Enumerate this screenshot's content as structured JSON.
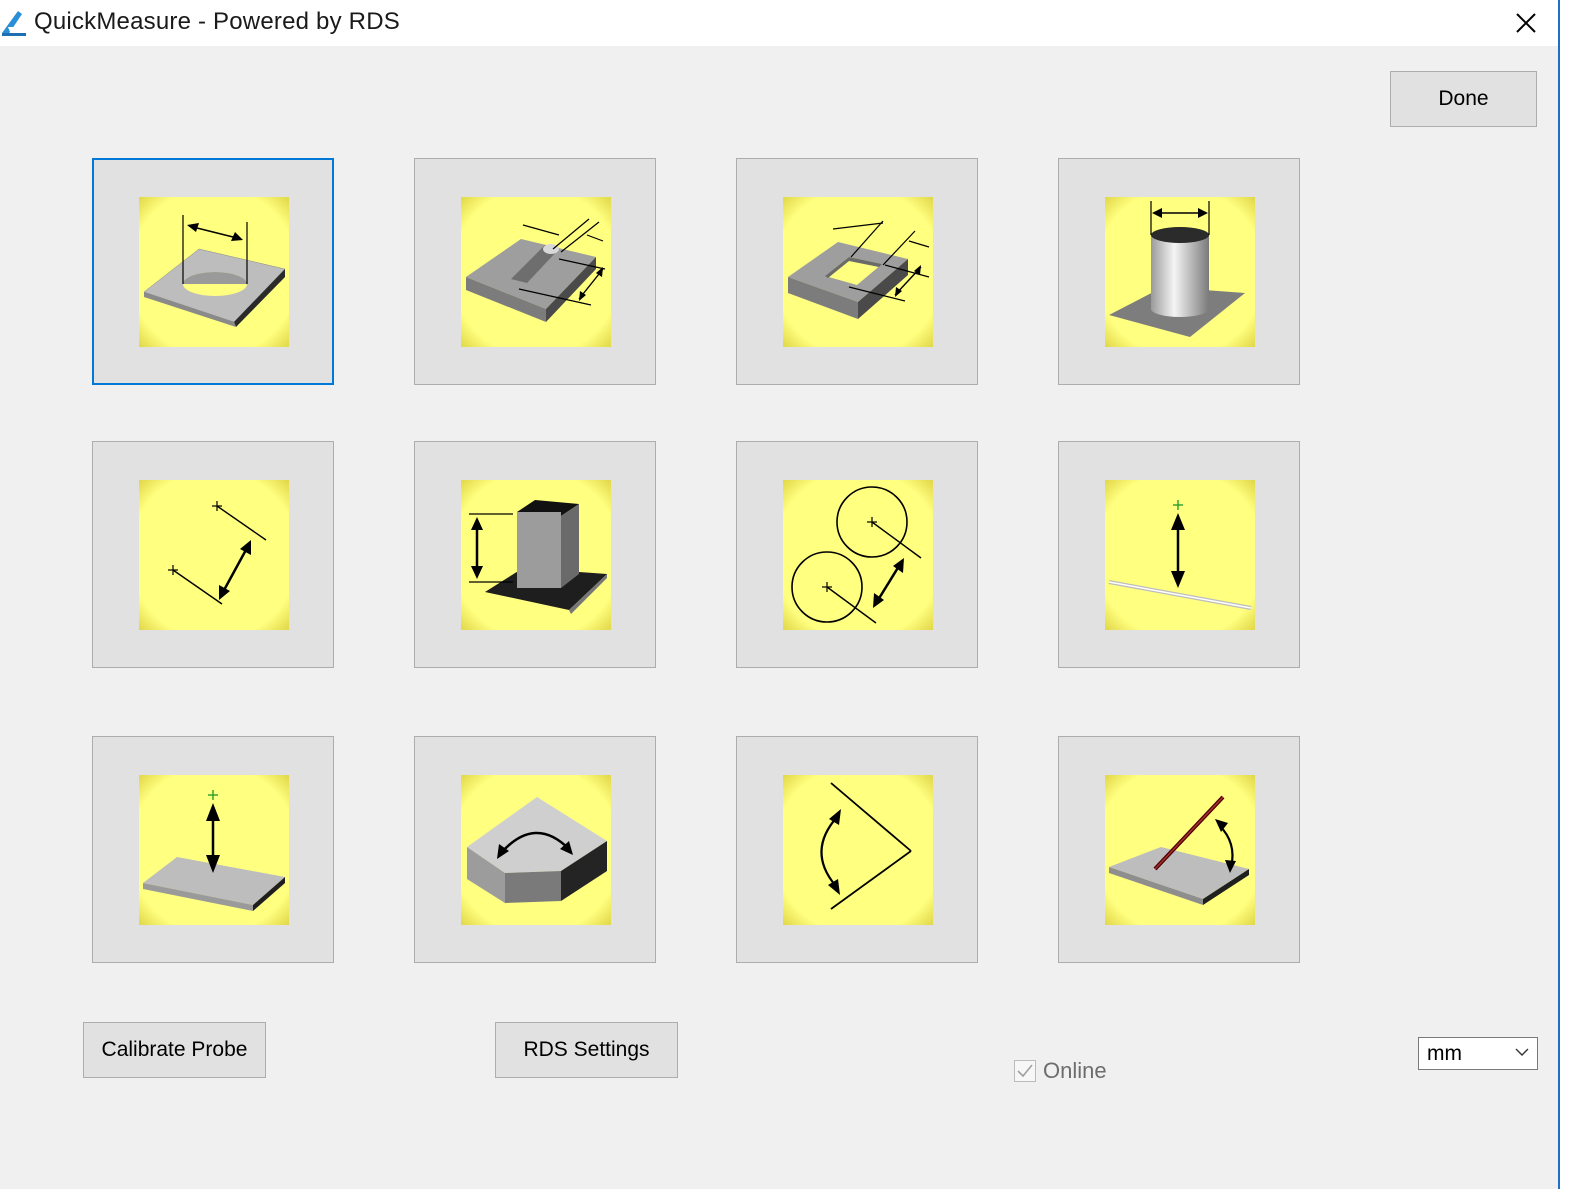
{
  "window": {
    "title": "QuickMeasure - Powered by RDS",
    "icons": {
      "app": "ruler-triangle-icon",
      "close": "close-icon"
    }
  },
  "buttons": {
    "done": "Done",
    "calibrate_probe": "Calibrate Probe",
    "rds_settings": "RDS Settings"
  },
  "online": {
    "label": "Online",
    "checked": true,
    "enabled": false
  },
  "units": {
    "selected": "mm"
  },
  "tiles": [
    {
      "icon": "hole-diameter-icon",
      "selected": true
    },
    {
      "icon": "slot-width-icon"
    },
    {
      "icon": "pocket-width-icon"
    },
    {
      "icon": "boss-diameter-icon"
    },
    {
      "icon": "point-to-point-distance-icon"
    },
    {
      "icon": "pillar-height-icon"
    },
    {
      "icon": "circle-to-circle-distance-icon"
    },
    {
      "icon": "point-to-line-distance-icon"
    },
    {
      "icon": "point-to-plane-distance-icon"
    },
    {
      "icon": "face-angle-icon"
    },
    {
      "icon": "line-to-line-angle-icon"
    },
    {
      "icon": "line-to-plane-angle-icon"
    }
  ],
  "colors": {
    "tile_image_bg": "#ffff80",
    "selected_border": "#0078d7",
    "window_bg": "#f0f0f0"
  }
}
